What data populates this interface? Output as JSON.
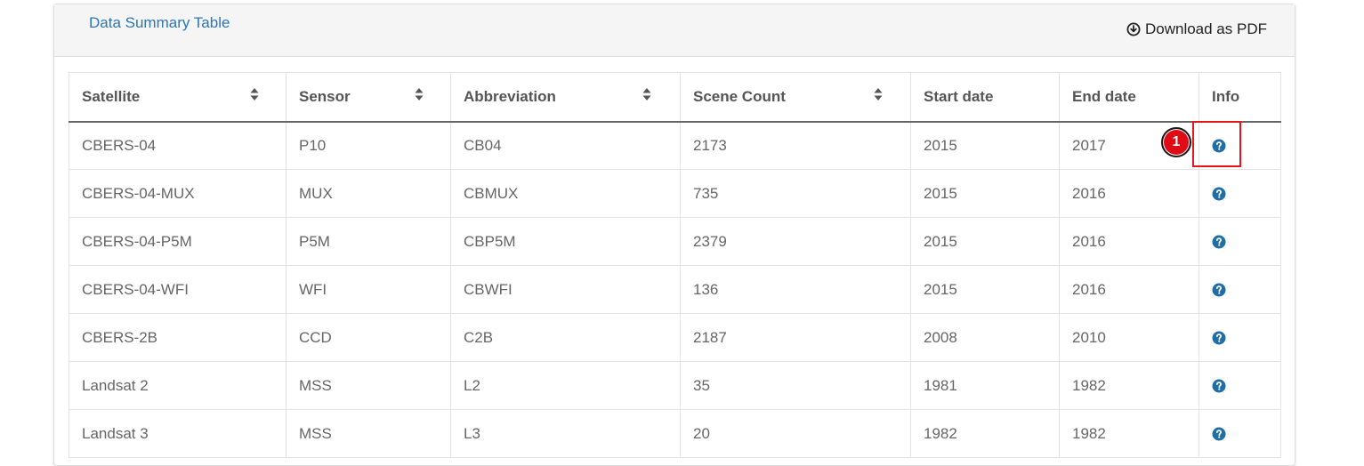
{
  "panel": {
    "title": "Data Summary Table",
    "download_label": "Download as PDF"
  },
  "table": {
    "headers": [
      "Satellite",
      "Sensor",
      "Abbreviation",
      "Scene Count",
      "Start date",
      "End date",
      "Info"
    ],
    "rows": [
      [
        "CBERS-04",
        "P10",
        "CB04",
        "2173",
        "2015",
        "2017"
      ],
      [
        "CBERS-04-MUX",
        "MUX",
        "CBMUX",
        "735",
        "2015",
        "2016"
      ],
      [
        "CBERS-04-P5M",
        "P5M",
        "CBP5M",
        "2379",
        "2015",
        "2016"
      ],
      [
        "CBERS-04-WFI",
        "WFI",
        "CBWFI",
        "136",
        "2015",
        "2016"
      ],
      [
        "CBERS-2B",
        "CCD",
        "C2B",
        "2187",
        "2008",
        "2010"
      ],
      [
        "Landsat 2",
        "MSS",
        "L2",
        "35",
        "1981",
        "1982"
      ],
      [
        "Landsat 3",
        "MSS",
        "L3",
        "20",
        "1982",
        "1982"
      ]
    ]
  },
  "annotation": {
    "marker_label": "1"
  },
  "icons": {
    "sort": "sort-icon",
    "info": "question-circle-icon",
    "download": "download-circle-icon"
  },
  "colors": {
    "link": "#2a76b8",
    "info_icon": "#1f6fa6",
    "highlight": "#e8141c"
  }
}
